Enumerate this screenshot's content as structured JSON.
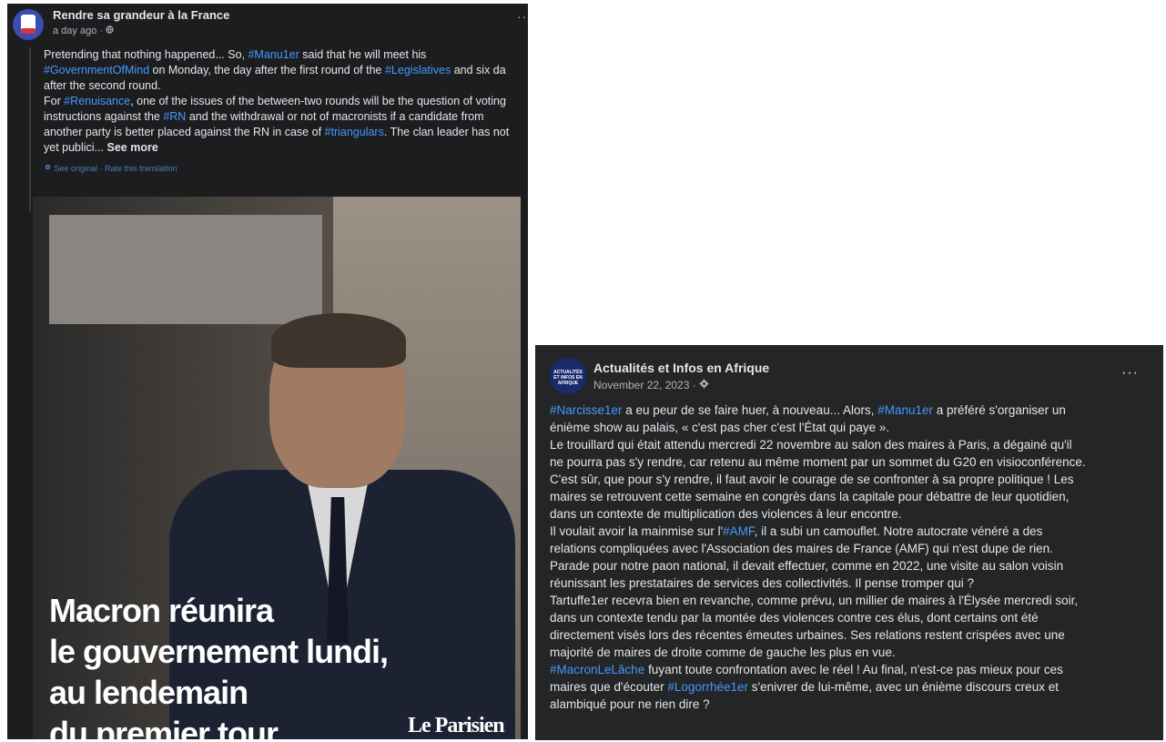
{
  "post_left": {
    "page_name": "Rendre sa grandeur à la France",
    "meta": "a day ago ·",
    "more": "···",
    "lines": [
      [
        {
          "t": "Pretending that nothing happened... So, "
        },
        {
          "t": "#Manu1er",
          "tag": true
        },
        {
          "t": " said that he will meet his"
        }
      ],
      [
        {
          "t": "#GovernmentOfMind",
          "tag": true
        },
        {
          "t": " on Monday, the day after the first round of the "
        },
        {
          "t": "#Legislatives",
          "tag": true
        },
        {
          "t": " and six da"
        }
      ],
      [
        {
          "t": "after the second round."
        }
      ],
      [
        {
          "t": "For "
        },
        {
          "t": "#Renuisance",
          "tag": true
        },
        {
          "t": ", one of the issues of the between-two rounds will be the question of voting"
        }
      ],
      [
        {
          "t": "instructions against the "
        },
        {
          "t": "#RN",
          "tag": true
        },
        {
          "t": " and the withdrawal or not of macronists if a candidate from"
        }
      ],
      [
        {
          "t": "another party is better placed against the RN in case of "
        },
        {
          "t": "#triangulars",
          "tag": true
        },
        {
          "t": ". The clan leader has not"
        }
      ],
      [
        {
          "t": "yet publici... "
        },
        {
          "t": "See more",
          "strong": true
        }
      ]
    ],
    "translate_label": "See original · Rate this translation",
    "image": {
      "headline": "Macron réunira\nle gouvernement lundi,\nau lendemain\ndu premier tour",
      "brand": "Le Parisien"
    }
  },
  "post_right": {
    "page_name": "Actualités et Infos en Afrique",
    "meta": "November 22, 2023 ·",
    "more": "···",
    "avatar_text": "ACTUALITÉS ET INFOS EN AFRIQUE",
    "lines": [
      [
        {
          "t": "#Narcisse1er",
          "tag": true
        },
        {
          "t": " a eu peur de se faire huer, à nouveau... Alors, "
        },
        {
          "t": "#Manu1er",
          "tag": true
        },
        {
          "t": " a préféré s'organiser un"
        }
      ],
      [
        {
          "t": "énième show au palais, « c'est pas cher c'est l'État qui paye »."
        }
      ],
      [
        {
          "t": "Le trouillard qui était attendu mercredi 22 novembre au salon des maires à Paris, a dégainé qu'il"
        }
      ],
      [
        {
          "t": "ne pourra pas s'y rendre, car retenu au même moment par un sommet du G20 en visioconférence."
        }
      ],
      [
        {
          "t": "C'est sûr, que pour s'y rendre, il faut avoir le courage de se confronter à sa propre politique ! Les"
        }
      ],
      [
        {
          "t": "maires se retrouvent cette semaine en congrès dans la capitale pour débattre de leur quotidien,"
        }
      ],
      [
        {
          "t": "dans un contexte de multiplication des violences à leur encontre."
        }
      ],
      [
        {
          "t": "Il voulait avoir la mainmise sur l'"
        },
        {
          "t": "#AMF",
          "tag": true
        },
        {
          "t": ", il a subi un camouflet. Notre autocrate vénéré a des"
        }
      ],
      [
        {
          "t": "relations compliquées avec l'Association des maires de France (AMF) qui n'est dupe de rien."
        }
      ],
      [
        {
          "t": "Parade pour notre paon national, il devait effectuer, comme en 2022, une visite au salon voisin"
        }
      ],
      [
        {
          "t": "réunissant les prestataires de services des collectivités. Il pense tromper qui ?"
        }
      ],
      [
        {
          "t": "Tartuffe1er recevra bien en revanche, comme prévu, un millier de maires à l'Élysée mercredi soir,"
        }
      ],
      [
        {
          "t": "dans un contexte tendu par la montée des violences contre ces élus, dont certains ont été"
        }
      ],
      [
        {
          "t": "directement visés lors des récentes émeutes urbaines. Ses relations restent crispées avec une"
        }
      ],
      [
        {
          "t": "majorité de maires de droite comme de gauche les plus en vue."
        }
      ],
      [
        {
          "t": "#MacronLeLâche",
          "tag": true
        },
        {
          "t": " fuyant toute confrontation avec le réel ! Au final, n'est-ce pas mieux pour ces"
        }
      ],
      [
        {
          "t": "maires que d'écouter "
        },
        {
          "t": "#Logorrhée1er",
          "tag": true
        },
        {
          "t": " s'enivrer de lui-même, avec un énième discours creux et"
        }
      ],
      [
        {
          "t": "alambiqué pour ne rien dire ?"
        }
      ]
    ]
  },
  "colors": {
    "hashtag": "#4599ff",
    "left_bg": "#1c1d1f",
    "right_bg": "#242526",
    "text": "#e4e6eb",
    "meta": "#b0b3b8"
  },
  "icons": [
    "globe-icon",
    "gear-icon",
    "more-options-icon",
    "page-avatar-icon"
  ]
}
